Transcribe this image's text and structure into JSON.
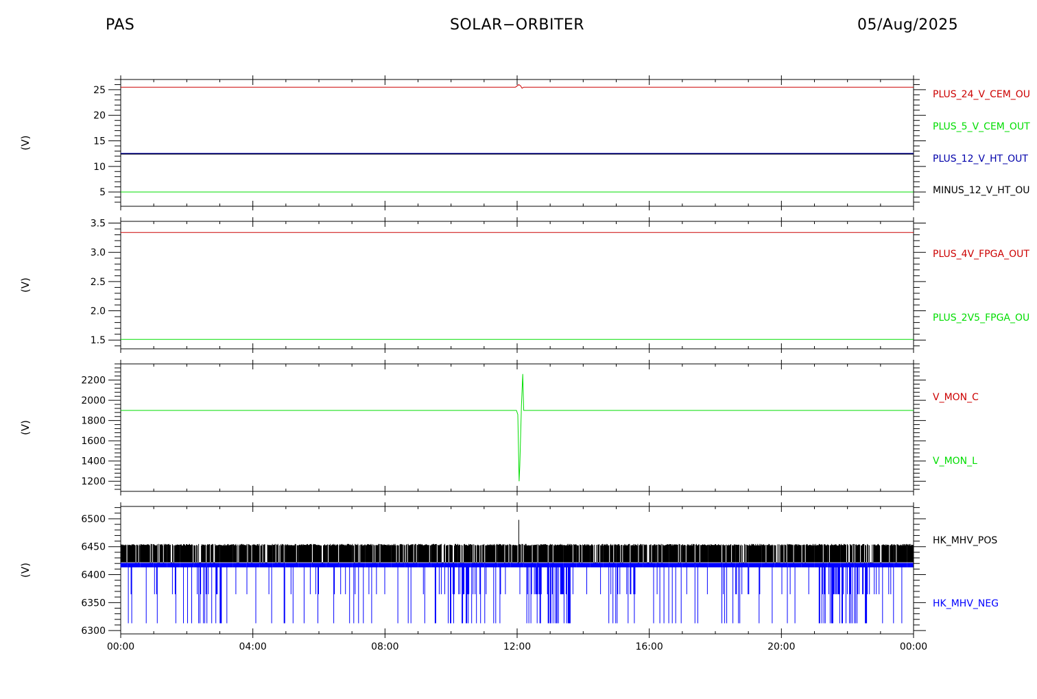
{
  "header": {
    "left": "PAS",
    "center": "SOLAR−ORBITER",
    "right": "05/Aug/2025"
  },
  "x_ticks": [
    "00:00",
    "04:00",
    "08:00",
    "12:00",
    "16:00",
    "20:00",
    "00:00"
  ],
  "chart_data": [
    {
      "type": "line",
      "ylabel": "(V)",
      "ylim": [
        2.2,
        27
      ],
      "yticks": [
        5,
        10,
        15,
        20,
        25
      ],
      "xlim": [
        0,
        24
      ],
      "series": [
        {
          "name": "PLUS_24_V_CEM_OU",
          "color": "#cc0000",
          "x": [
            0,
            11.95,
            12.05,
            12.1,
            12.15,
            12.2,
            24
          ],
          "y": [
            25.5,
            25.5,
            26.0,
            25.8,
            25.3,
            25.5,
            25.5
          ]
        },
        {
          "name": "PLUS_5_V_CEM_OUT",
          "color": "#00dd00",
          "x": [
            0,
            24
          ],
          "y": [
            5.0,
            5.0
          ]
        },
        {
          "name": "PLUS_12_V_HT_OUT",
          "color": "#0000aa",
          "x": [
            0,
            24
          ],
          "y": [
            12.5,
            12.5
          ]
        },
        {
          "name": "MINUS_12_V_HT_OU",
          "color": "#000000",
          "x": [
            0,
            24
          ],
          "y": [
            12.4,
            12.4
          ]
        }
      ]
    },
    {
      "type": "line",
      "ylabel": "(V)",
      "ylim": [
        1.35,
        3.53
      ],
      "yticks": [
        1.5,
        2.0,
        2.5,
        3.0,
        3.5
      ],
      "xlim": [
        0,
        24
      ],
      "series": [
        {
          "name": "PLUS_4V_FPGA_OUT",
          "color": "#cc0000",
          "x": [
            0,
            24
          ],
          "y": [
            3.34,
            3.34
          ]
        },
        {
          "name": "PLUS_2V5_FPGA_OU",
          "color": "#00dd00",
          "x": [
            0,
            24
          ],
          "y": [
            1.51,
            1.51
          ]
        }
      ]
    },
    {
      "type": "line",
      "ylabel": "(V)",
      "ylim": [
        1100,
        2360
      ],
      "yticks": [
        1200,
        1400,
        1600,
        1800,
        2000,
        2200
      ],
      "xlim": [
        0,
        24
      ],
      "series": [
        {
          "name": "V_MON_C",
          "color": "#cc0000",
          "x": [],
          "y": []
        },
        {
          "name": "V_MON_L",
          "color": "#00dd00",
          "x": [
            0,
            11.98,
            12.02,
            12.06,
            12.08,
            12.13,
            12.17,
            12.2,
            12.25,
            24
          ],
          "y": [
            1900,
            1900,
            1860,
            1200,
            1350,
            1950,
            2260,
            1900,
            1900,
            1900
          ]
        }
      ]
    },
    {
      "type": "line",
      "ylabel": "(V)",
      "ylim": [
        6294,
        6522
      ],
      "yticks": [
        6300,
        6350,
        6400,
        6450,
        6500
      ],
      "xlim": [
        0,
        24
      ],
      "series": [
        {
          "name": "HK_MHV_POS",
          "color": "#000000",
          "base": 6420,
          "high": 6455,
          "spike": {
            "x": 12.05,
            "y": 6498
          }
        },
        {
          "name": "HK_MHV_NEG",
          "color": "#0000ff",
          "base": 6418,
          "low": 6313,
          "mid": 6365
        }
      ]
    }
  ]
}
